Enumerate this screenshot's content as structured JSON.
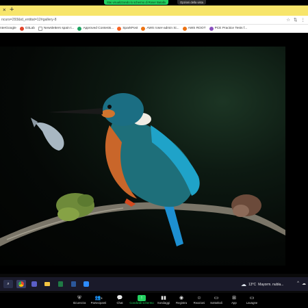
{
  "share": {
    "banner": "Stai visualizzando lo schermo di Roser Batalla",
    "options": "Opzioni della vista"
  },
  "browser": {
    "tab_close": "×",
    "new_tab": "+",
    "url": "ncurs=293&id_entitat=12#gallery-8",
    "addr_icons": [
      "☆",
      "⇅",
      "⋮"
    ]
  },
  "bookmarks": [
    {
      "label": "nterGoogle",
      "icon_color": "#4285f4",
      "icon": "G-icon"
    },
    {
      "label": "GitLab",
      "icon_color": "#e24329",
      "icon": "gitlab-icon"
    },
    {
      "label": "Newsletters spain t...",
      "icon_color": "#666666",
      "icon": "page-icon"
    },
    {
      "label": "Approved Contests...",
      "icon_color": "#1da462",
      "icon": "check-icon"
    },
    {
      "label": "SparkPost",
      "icon_color": "#fa6423",
      "icon": "sparkpost-icon"
    },
    {
      "label": "AWS roser-admin Si...",
      "icon_color": "#ec7211",
      "icon": "aws-icon"
    },
    {
      "label": "AWS ROOT",
      "icon_color": "#ec7211",
      "icon": "aws-icon"
    },
    {
      "label": "PCE Practice Tests f...",
      "icon_color": "#8a4fbf",
      "icon": "pce-icon"
    }
  ],
  "taskbar": {
    "apps": [
      "search",
      "chrome",
      "teams",
      "explorer",
      "excel",
      "word",
      "zoom"
    ],
    "weather_temp": "13°C",
    "weather_desc": "Mayorm. nubla...",
    "tray": [
      "^",
      "☁",
      "🔊"
    ]
  },
  "zoom_bar": [
    {
      "label": "Sicurezza",
      "icon": "shield-icon",
      "glyph": "⛨"
    },
    {
      "label": "Partecipanti",
      "icon": "participants-icon",
      "glyph": "👥",
      "count": "8"
    },
    {
      "label": "Chat",
      "icon": "chat-icon",
      "glyph": "💬"
    },
    {
      "label": "Condividi schermo",
      "icon": "share-screen-icon",
      "glyph": "↑",
      "active": true
    },
    {
      "label": "Sondaggi",
      "icon": "polls-icon",
      "glyph": "▮▮"
    },
    {
      "label": "Registra",
      "icon": "record-icon",
      "glyph": "◉"
    },
    {
      "label": "Reazioni",
      "icon": "reactions-icon",
      "glyph": "☺"
    },
    {
      "label": "Sottotitoli",
      "icon": "captions-icon",
      "glyph": "▭"
    },
    {
      "label": "App",
      "icon": "apps-icon",
      "glyph": "⊞"
    },
    {
      "label": "Lavagne",
      "icon": "whiteboard-icon",
      "glyph": "▭"
    }
  ]
}
